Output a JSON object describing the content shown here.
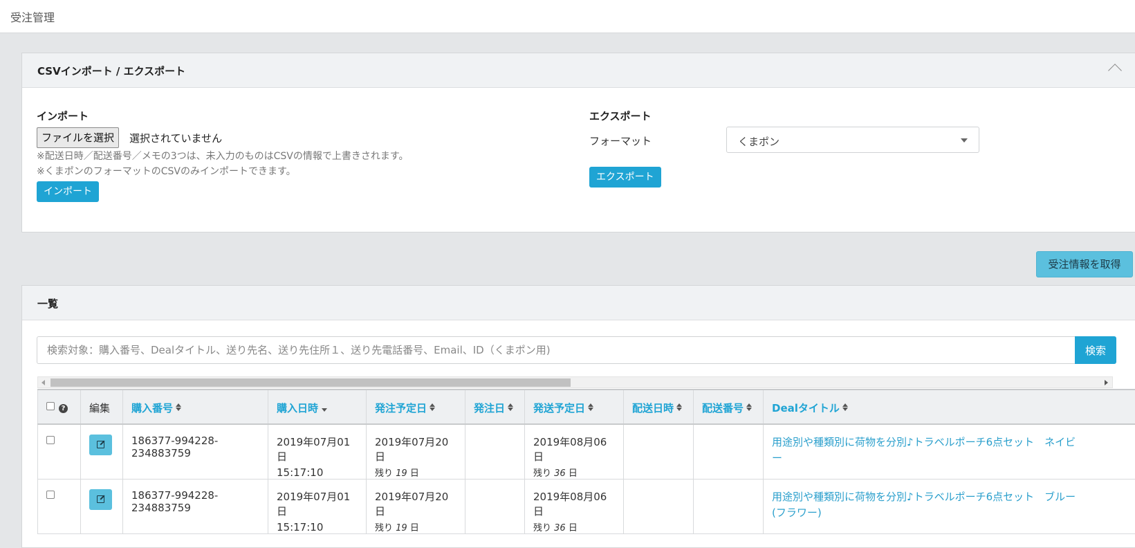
{
  "page": {
    "title": "受注管理"
  },
  "csv_panel": {
    "title": "CSVインポート / エクスポート",
    "import": {
      "heading": "インポート",
      "file_button": "ファイルを選択",
      "file_status": "選択されていません",
      "note1": "※配送日時／配送番号／メモの3つは、未入力のものはCSVの情報で上書きされます。",
      "note2": "※くまポンのフォーマットのCSVのみインポートできます。",
      "button": "インポート"
    },
    "export": {
      "heading": "エクスポート",
      "format_label": "フォーマット",
      "format_value": "くまポン",
      "button": "エクスポート"
    }
  },
  "fetch_button": "受注情報を取得",
  "list_panel": {
    "title": "一覧",
    "search": {
      "placeholder": "検索対象：購入番号、Dealタイトル、送り先名、送り先住所１、送り先電話番号、Email、ID（くまポン用)",
      "button": "検索"
    },
    "columns": {
      "edit": "編集",
      "purchase_no": "購入番号",
      "purchase_date": "購入日時",
      "order_planned": "発注予定日",
      "order_date": "発注日",
      "ship_planned": "発送予定日",
      "delivery_datetime": "配送日時",
      "delivery_no": "配送番号",
      "deal_title": "Dealタイトル"
    },
    "remain_prefix": "残り",
    "remain_suffix": "日",
    "rows": [
      {
        "purchase_no": "186377-994228-234883759",
        "purchase_date": "2019年07月01日",
        "purchase_time": "15:17:10",
        "order_planned": "2019年07月20日",
        "order_remain": "19",
        "order_date": "",
        "ship_planned": "2019年08月06日",
        "ship_remain": "36",
        "delivery_datetime": "",
        "delivery_no": "",
        "deal_line1": "用途別や種類別に荷物を分別♪トラベルポーチ6点セット　ネイビ",
        "deal_line2": "ー"
      },
      {
        "purchase_no": "186377-994228-234883759",
        "purchase_date": "2019年07月01日",
        "purchase_time": "15:17:10",
        "order_planned": "2019年07月20日",
        "order_remain": "19",
        "order_date": "",
        "ship_planned": "2019年08月06日",
        "ship_remain": "36",
        "delivery_datetime": "",
        "delivery_no": "",
        "deal_line1": "用途別や種類別に荷物を分別♪トラベルポーチ6点セット　ブルー",
        "deal_line2": "(フラワー)"
      }
    ]
  }
}
